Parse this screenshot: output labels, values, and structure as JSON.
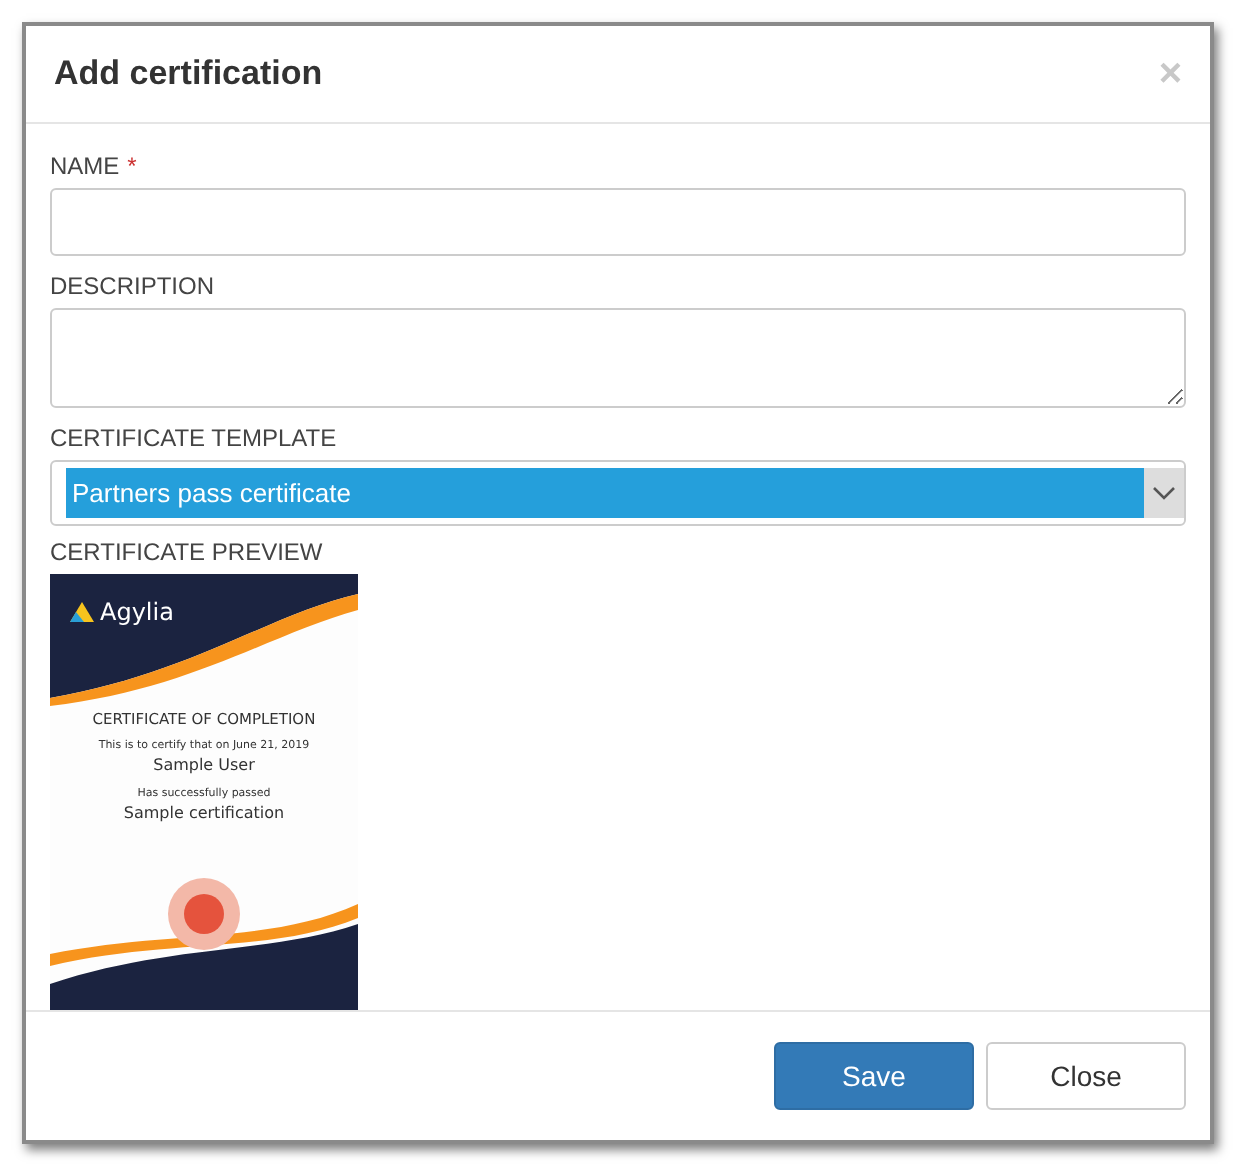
{
  "dialog": {
    "title": "Add certification",
    "close_symbol": "×"
  },
  "fields": [
    {
      "kind": "text",
      "label": "NAME",
      "required": true,
      "required_mark": "*"
    },
    {
      "kind": "textarea",
      "label": "DESCRIPTION",
      "required": false
    },
    {
      "kind": "select",
      "label": "CERTIFICATE TEMPLATE",
      "required": false,
      "value": "Partners pass certificate"
    }
  ],
  "preview": {
    "label": "CERTIFICATE PREVIEW",
    "logo": "Agylia",
    "heading": "CERTIFICATE OF COMPLETION",
    "line_1": "This is to certify that on June 21, 2019",
    "recipient": "Sample User",
    "line_2": "Has successfully passed",
    "course": "Sample certification"
  },
  "buttons": [
    {
      "label": "Save",
      "kind": "primary"
    },
    {
      "label": "Close",
      "kind": "default"
    }
  ]
}
